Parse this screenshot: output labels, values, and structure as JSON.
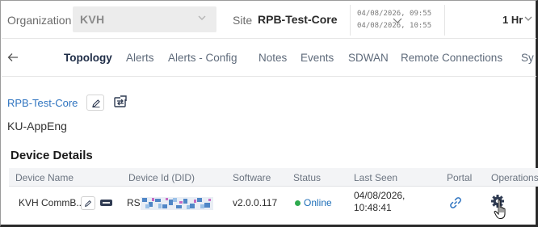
{
  "filters": {
    "organization_label": "Organization",
    "organization_value": "KVH",
    "site_label": "Site",
    "site_value": "RPB-Test-Core",
    "date_from": "04/08/2026, 09:55",
    "date_to": "04/08/2026, 10:55",
    "range_value": "1 Hr"
  },
  "tabs": [
    {
      "label": "Topology",
      "active": true
    },
    {
      "label": "Alerts",
      "active": false
    },
    {
      "label": "Alerts - Config",
      "active": false
    },
    {
      "label": "Notes",
      "active": false
    },
    {
      "label": "Events",
      "active": false
    },
    {
      "label": "SDWAN",
      "active": false
    },
    {
      "label": "Remote Connections",
      "active": false
    },
    {
      "label": "Sy",
      "active": false
    }
  ],
  "site": {
    "name": "RPB-Test-Core",
    "sub_name": "KU-AppEng"
  },
  "device_details": {
    "title": "Device Details",
    "columns": [
      "Device Name",
      "Device Id (DID)",
      "Software",
      "Status",
      "Last Seen",
      "Portal",
      "Operations"
    ],
    "rows": [
      {
        "device_name": "KVH CommB...",
        "device_id_prefix": "RS1",
        "software": "v2.0.0.117",
        "status": "Online",
        "last_seen_date": "04/08/2026,",
        "last_seen_time": "10:48:41"
      }
    ]
  },
  "colors": {
    "link_blue": "#2f74c0",
    "status_green": "#2eaa4e",
    "icon_navy": "#2f3b52"
  },
  "icons": [
    "chevron-down-icon",
    "arrow-down-icon",
    "back-arrow-icon",
    "pencil-icon",
    "swap-icon",
    "link-icon",
    "gear-icon",
    "hand-cursor-icon"
  ]
}
